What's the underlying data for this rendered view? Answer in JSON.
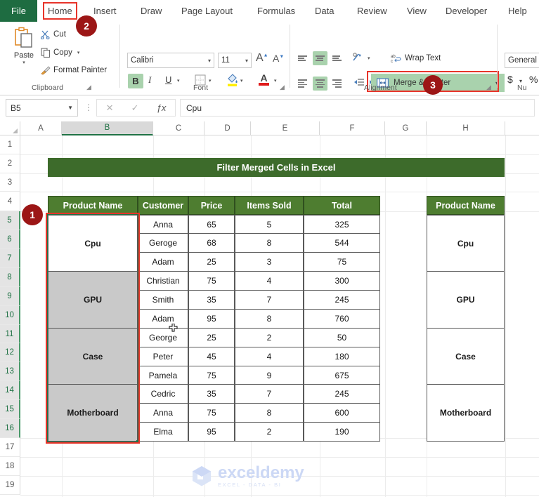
{
  "ribbon": {
    "tabs": [
      {
        "label": "File"
      },
      {
        "label": "Home"
      },
      {
        "label": "Insert"
      },
      {
        "label": "Draw"
      },
      {
        "label": "Page Layout"
      },
      {
        "label": "Formulas"
      },
      {
        "label": "Data"
      },
      {
        "label": "Review"
      },
      {
        "label": "View"
      },
      {
        "label": "Developer"
      },
      {
        "label": "Help"
      }
    ],
    "clipboard": {
      "group_label": "Clipboard",
      "paste_label": "Paste",
      "cut_label": "Cut",
      "copy_label": "Copy",
      "format_painter_label": "Format Painter"
    },
    "font": {
      "group_label": "Font",
      "font_name": "Calibri",
      "font_size": "11",
      "bold_label": "B",
      "italic_label": "I",
      "underline_label": "U",
      "grow_font_label": "A",
      "shrink_font_label": "A",
      "fill_color_label": "A",
      "font_color_label": "A"
    },
    "alignment": {
      "group_label": "Alignment",
      "wrap_text_label": "Wrap Text",
      "merge_center_label": "Merge & Center"
    },
    "number": {
      "group_label": "Nu",
      "format_value": "General",
      "currency_label": "$",
      "percent_label": "%"
    }
  },
  "formula_bar": {
    "name_box_value": "B5",
    "cancel_label": "✕",
    "enter_label": "✓",
    "fx_label": "ƒx",
    "formula_value": "Cpu"
  },
  "grid": {
    "columns": [
      "A",
      "B",
      "C",
      "D",
      "E",
      "F",
      "G",
      "H"
    ],
    "selected_column": "B",
    "rows": [
      "1",
      "2",
      "3",
      "4",
      "5",
      "6",
      "7",
      "8",
      "9",
      "10",
      "11",
      "12",
      "13",
      "14",
      "15",
      "16",
      "17",
      "18",
      "19"
    ],
    "selected_rows": [
      "5",
      "6",
      "7",
      "8",
      "9",
      "10",
      "11",
      "12",
      "13",
      "14",
      "15",
      "16"
    ]
  },
  "sheet": {
    "title_banner": "Filter Merged Cells in Excel",
    "table": {
      "headers": [
        "Product Name",
        "Customer",
        "Price",
        "Items Sold",
        "Total"
      ],
      "groups": [
        {
          "product": "Cpu",
          "highlighted": false,
          "rows": [
            {
              "customer": "Anna",
              "price": "65",
              "items_sold": "5",
              "total": "325"
            },
            {
              "customer": "Geroge",
              "price": "68",
              "items_sold": "8",
              "total": "544"
            },
            {
              "customer": "Adam",
              "price": "25",
              "items_sold": "3",
              "total": "75"
            }
          ]
        },
        {
          "product": "GPU",
          "highlighted": true,
          "rows": [
            {
              "customer": "Christian",
              "price": "75",
              "items_sold": "4",
              "total": "300"
            },
            {
              "customer": "Smith",
              "price": "35",
              "items_sold": "7",
              "total": "245"
            },
            {
              "customer": "Adam",
              "price": "95",
              "items_sold": "8",
              "total": "760"
            }
          ]
        },
        {
          "product": "Case",
          "highlighted": true,
          "rows": [
            {
              "customer": "George",
              "price": "25",
              "items_sold": "2",
              "total": "50"
            },
            {
              "customer": "Peter",
              "price": "45",
              "items_sold": "4",
              "total": "180"
            },
            {
              "customer": "Pamela",
              "price": "75",
              "items_sold": "9",
              "total": "675"
            }
          ]
        },
        {
          "product": "Motherboard",
          "highlighted": true,
          "rows": [
            {
              "customer": "Cedric",
              "price": "35",
              "items_sold": "7",
              "total": "245"
            },
            {
              "customer": "Anna",
              "price": "75",
              "items_sold": "8",
              "total": "600"
            },
            {
              "customer": "Elma",
              "price": "95",
              "items_sold": "2",
              "total": "190"
            }
          ]
        }
      ]
    },
    "side_table": {
      "header": "Product Name",
      "values": [
        "Cpu",
        "GPU",
        "Case",
        "Motherboard"
      ]
    }
  },
  "callouts": [
    {
      "number": "1"
    },
    {
      "number": "2"
    },
    {
      "number": "3"
    }
  ],
  "watermark": {
    "name": "exceldemy",
    "tagline": "EXCEL - DATA - BI"
  },
  "colors": {
    "excel_green": "#217346",
    "file_tab": "#1e6c41",
    "banner_green": "#3d6b2b",
    "header_green": "#4e7d30",
    "callout_red": "#9c1616",
    "highlight_red": "#e8342a",
    "selected_gray": "#c9c9c9"
  }
}
